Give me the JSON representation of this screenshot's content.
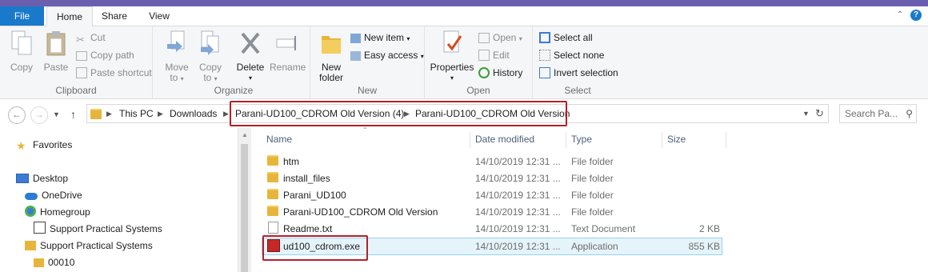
{
  "ribbon_tabs": {
    "file": "File",
    "home": "Home",
    "share": "Share",
    "view": "View"
  },
  "clipboard": {
    "copy": "Copy",
    "paste": "Paste",
    "cut": "Cut",
    "copy_path": "Copy path",
    "paste_shortcut": "Paste shortcut",
    "label": "Clipboard"
  },
  "organize": {
    "move_to_1": "Move",
    "move_to_2": "to",
    "copy_to_1": "Copy",
    "copy_to_2": "to",
    "delete": "Delete",
    "rename": "Rename",
    "label": "Organize"
  },
  "new_group": {
    "new_folder_1": "New",
    "new_folder_2": "folder",
    "new_item": "New item",
    "easy_access": "Easy access",
    "label": "New"
  },
  "open_group": {
    "properties": "Properties",
    "open": "Open",
    "edit": "Edit",
    "history": "History",
    "label": "Open"
  },
  "select_group": {
    "select_all": "Select all",
    "select_none": "Select none",
    "invert_selection": "Invert selection",
    "label": "Select"
  },
  "breadcrumb": {
    "this_pc": "This PC",
    "downloads": "Downloads",
    "parent": "Parani-UD100_CDROM Old Version (4)",
    "current": "Parani-UD100_CDROM Old Version"
  },
  "search": {
    "placeholder": "Search Pa..."
  },
  "nav": {
    "favorites": "Favorites",
    "desktop": "Desktop",
    "onedrive": "OneDrive",
    "homegroup": "Homegroup",
    "support_user": "Support Practical Systems",
    "support_folder": "Support Practical Systems",
    "folder_00010": "00010"
  },
  "columns": {
    "name": "Name",
    "date": "Date modified",
    "type": "Type",
    "size": "Size"
  },
  "files": [
    {
      "name": "htm",
      "date": "14/10/2019 12:31 ...",
      "type": "File folder",
      "size": ""
    },
    {
      "name": "install_files",
      "date": "14/10/2019 12:31 ...",
      "type": "File folder",
      "size": ""
    },
    {
      "name": "Parani_UD100",
      "date": "14/10/2019 12:31 ...",
      "type": "File folder",
      "size": ""
    },
    {
      "name": "Parani-UD100_CDROM Old Version",
      "date": "14/10/2019 12:31 ...",
      "type": "File folder",
      "size": ""
    },
    {
      "name": "Readme.txt",
      "date": "14/10/2019 12:31 ...",
      "type": "Text Document",
      "size": "2 KB"
    },
    {
      "name": "ud100_cdrom.exe",
      "date": "14/10/2019 12:31 ...",
      "type": "Application",
      "size": "855 KB"
    }
  ],
  "colors": {
    "accent": "#1979ca",
    "highlight": "#b32029",
    "selected_row": "#e5f3fb",
    "folder": "#e8b53c"
  }
}
